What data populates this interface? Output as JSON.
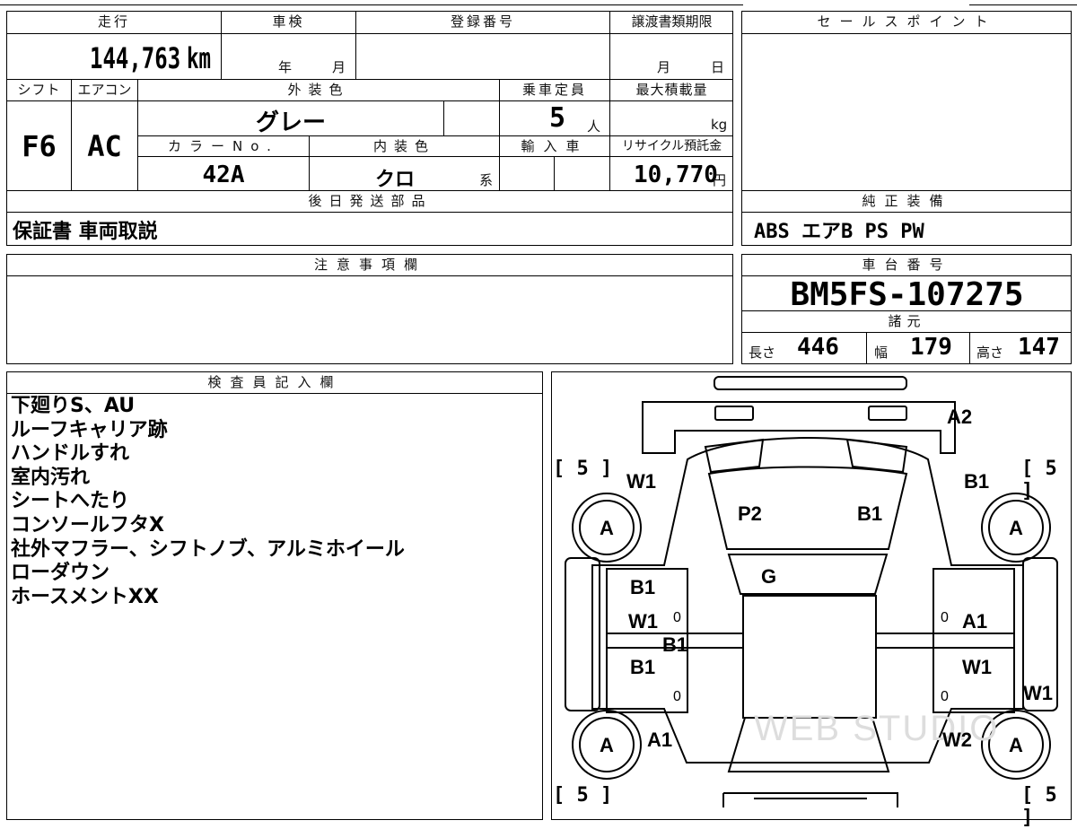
{
  "headers": {
    "mileage": "走行",
    "shaken": "車検",
    "registration": "登録番号",
    "transfer_deadline": "譲渡書類期限",
    "sales_point": "セールスポイント",
    "shift": "シフト",
    "aircon": "エアコン",
    "exterior_color": "外装色",
    "capacity": "乗車定員",
    "max_load": "最大積載量",
    "color_no": "カラーNo.",
    "interior_color": "内装色",
    "import": "輸入車",
    "recycle": "リサイクル預託金",
    "delivery_later": "後日発送部品",
    "genuine_equipment": "純正装備",
    "notes": "注意事項欄",
    "chassis_no": "車台番号",
    "specs": "諸元",
    "inspector": "検査員記入欄"
  },
  "values": {
    "mileage": "144,763",
    "mileage_unit": "km",
    "year_unit": "年",
    "month_unit": "月",
    "deadline_month": "月",
    "deadline_day": "日",
    "shift": "F6",
    "aircon": "AC",
    "exterior_color": "グレー",
    "capacity": "5",
    "capacity_unit": "人",
    "load_unit": "kg",
    "color_no": "42A",
    "interior_color": "クロ",
    "interior_suffix": "系",
    "recycle_fee": "10,770",
    "recycle_unit": "円",
    "delivery_later": "保証書 車両取説",
    "genuine_equipment": "ABS エアB PS PW",
    "chassis_no": "BM5FS-107275",
    "length_label": "長さ",
    "length": "446",
    "width_label": "幅",
    "width": "179",
    "height_label": "高さ",
    "height": "147"
  },
  "inspector_notes": [
    "下廻りS、AU",
    "ルーフキャリア跡",
    "ハンドルすれ",
    "室内汚れ",
    "シートへたり",
    "コンソールフタX",
    "社外マフラー、シフトノブ、アルミホイール",
    "ローダウン",
    "ホースメントXX"
  ],
  "diagram": {
    "labels": {
      "a2": "A2",
      "w1_fl": "W1",
      "b1_fr": "B1",
      "p2": "P2",
      "b1_hood": "B1",
      "g": "G",
      "b1_ld1": "B1",
      "w1_ld": "W1",
      "b1_pillar": "B1",
      "b1_ld2": "B1",
      "a1_rd": "A1",
      "w1_rd": "W1",
      "w1_rside": "W1",
      "a1_rr": "A1",
      "w2_rr": "W2",
      "tire_fl": "A",
      "tire_fr": "A",
      "tire_rl": "A",
      "tire_rr": "A",
      "zero1": "0",
      "zero2": "0",
      "zero3": "0",
      "zero4": "0"
    },
    "tread": "5",
    "watermark": "WEB STUDIO"
  }
}
